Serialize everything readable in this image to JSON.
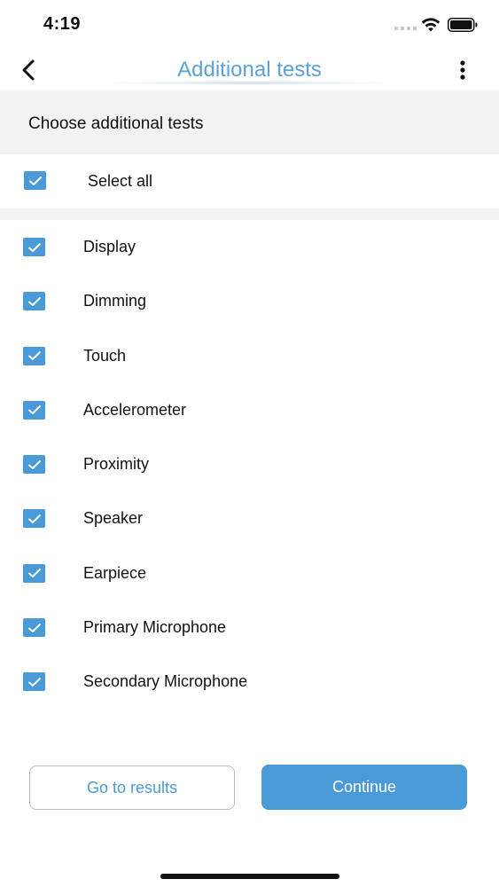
{
  "status_bar": {
    "time": "4:19"
  },
  "nav": {
    "title": "Additional tests",
    "back_icon": "chevron-left-icon",
    "more_icon": "more-vertical-icon"
  },
  "section": {
    "header": "Choose additional tests"
  },
  "select_all": {
    "label": "Select all",
    "checked": true
  },
  "tests": [
    {
      "label": "Display",
      "checked": true
    },
    {
      "label": "Dimming",
      "checked": true
    },
    {
      "label": "Touch",
      "checked": true
    },
    {
      "label": "Accelerometer",
      "checked": true
    },
    {
      "label": "Proximity",
      "checked": true
    },
    {
      "label": "Speaker",
      "checked": true
    },
    {
      "label": "Earpiece",
      "checked": true
    },
    {
      "label": "Primary Microphone",
      "checked": true
    },
    {
      "label": "Secondary Microphone",
      "checked": true
    }
  ],
  "buttons": {
    "go_to_results": "Go to results",
    "continue": "Continue"
  },
  "colors": {
    "accent": "#4a9ad8",
    "title": "#5aa2d8",
    "section_bg": "#f2f2f3"
  }
}
